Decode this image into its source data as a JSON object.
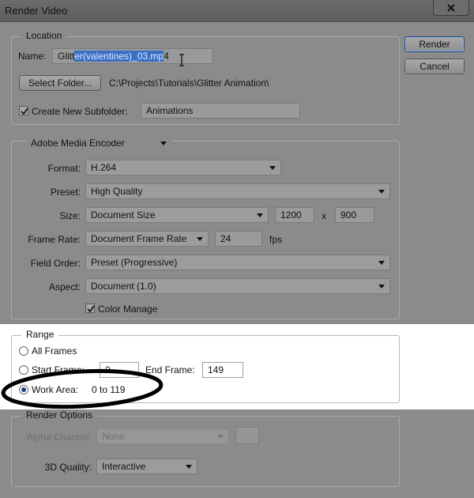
{
  "window": {
    "title": "Render Video"
  },
  "buttons": {
    "render": "Render",
    "cancel": "Cancel"
  },
  "location": {
    "legend": "Location",
    "name_label": "Name:",
    "name_value_pre": "Glitt",
    "name_value_selected": "er(valentines)_03.mp",
    "name_value_post": "4",
    "select_folder_label": "Select Folder...",
    "folder_path": "C:\\Projects\\Tutorials\\Glitter Animation\\",
    "create_subfolder_label": "Create New Subfolder:",
    "create_subfolder_checked": true,
    "subfolder_value": "Animations"
  },
  "encoder": {
    "selected": "Adobe Media Encoder",
    "format_label": "Format:",
    "format_value": "H.264",
    "preset_label": "Preset:",
    "preset_value": "High Quality",
    "size_label": "Size:",
    "size_value": "Document Size",
    "width_value": "1200",
    "x_sep": "x",
    "height_value": "900",
    "framerate_label": "Frame Rate:",
    "framerate_value": "Document Frame Rate",
    "fps_value": "24",
    "fps_unit": "fps",
    "field_order_label": "Field Order:",
    "field_order_value": "Preset (Progressive)",
    "aspect_label": "Aspect:",
    "aspect_value": "Document (1.0)",
    "color_manage_label": "Color Manage",
    "color_manage_checked": true
  },
  "range": {
    "legend": "Range",
    "all_frames_label": "All Frames",
    "start_frame_label": "Start Frame:",
    "start_frame_value": "0",
    "end_frame_label": "End Frame:",
    "end_frame_value": "149",
    "work_area_label": "Work Area:",
    "work_area_value": "0 to 119",
    "selected_option": "Work Area"
  },
  "render_options": {
    "legend": "Render Options",
    "alpha_label": "Alpha Channel:",
    "alpha_value": "None",
    "quality_label": "3D Quality:",
    "quality_value": "Interactive"
  },
  "colors": {
    "selection": "#3b6fc4",
    "annotation": "#000000"
  }
}
